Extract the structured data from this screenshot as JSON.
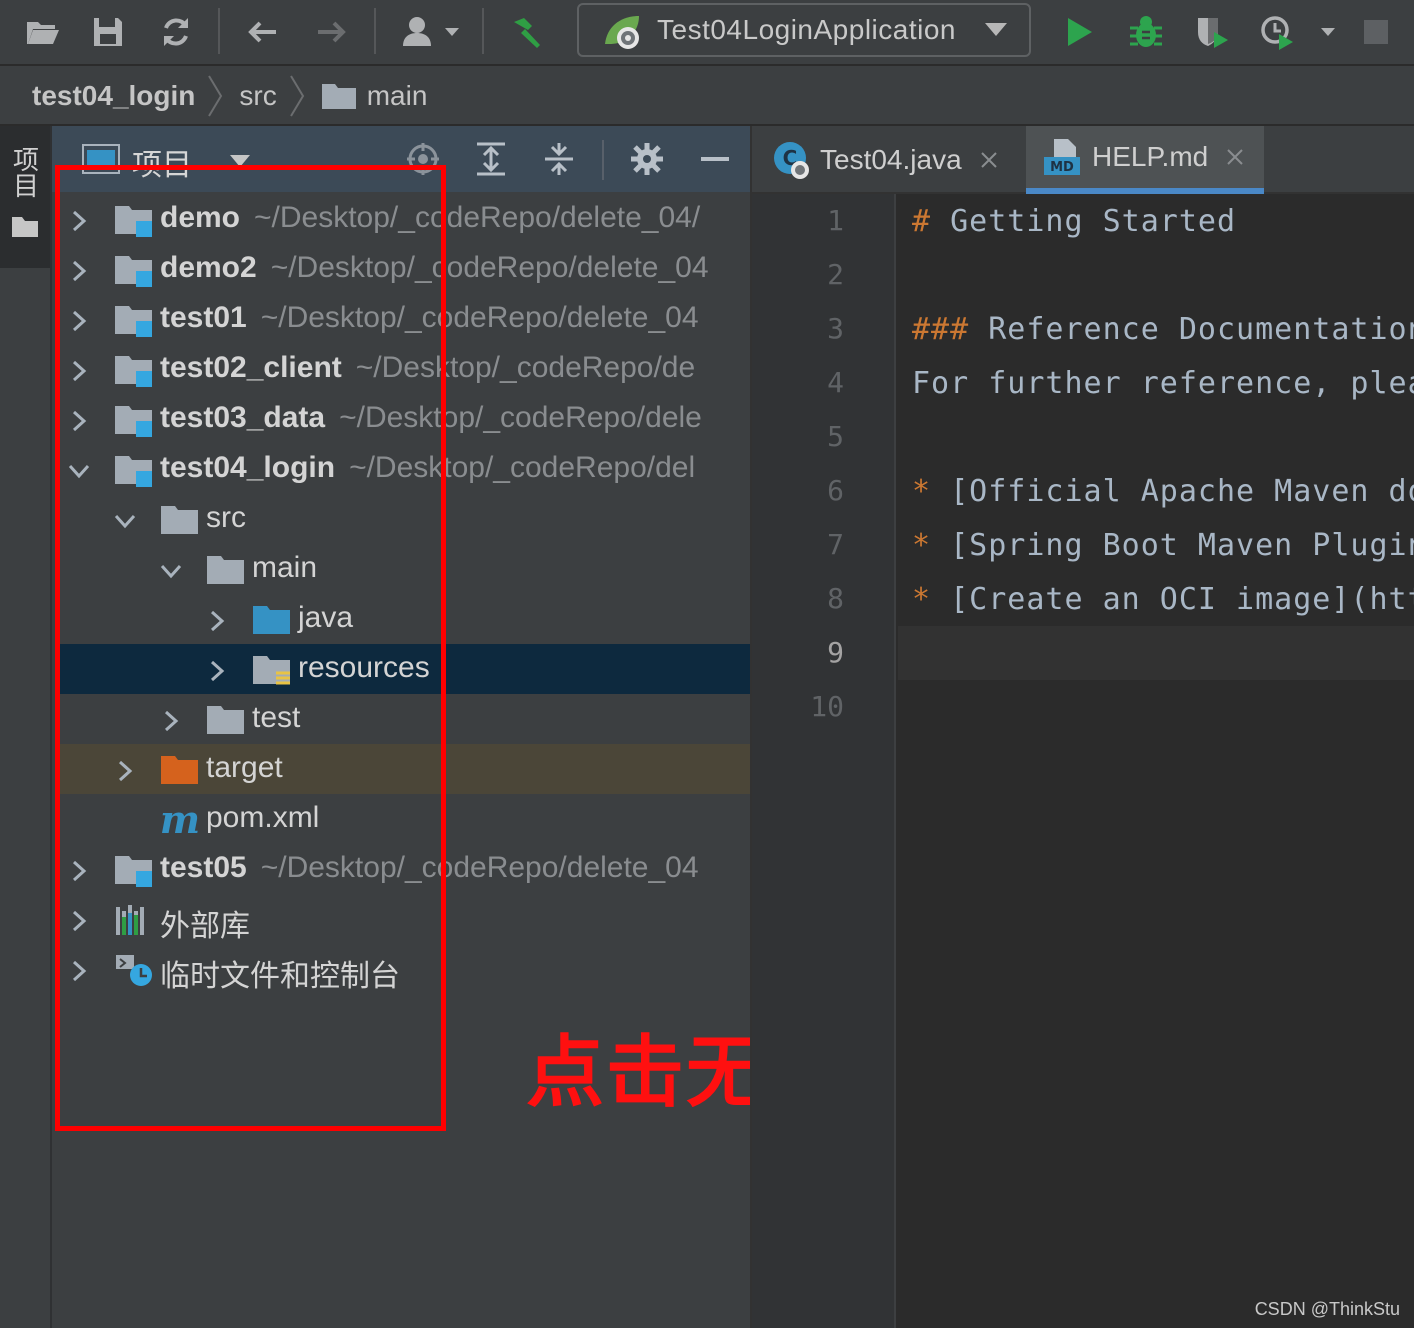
{
  "toolbar": {
    "run_config": "Test04LoginApplication"
  },
  "breadcrumb": [
    "test04_login",
    "src",
    "main"
  ],
  "left_strip": {
    "tab_label": "项目"
  },
  "project_panel": {
    "title": "项目",
    "tree": [
      {
        "name": "demo",
        "path": "~/Desktop/_codeRepo/delete_04/",
        "type": "module",
        "depth": 0,
        "expanded": false
      },
      {
        "name": "demo2",
        "path": "~/Desktop/_codeRepo/delete_04",
        "type": "module",
        "depth": 0,
        "expanded": false
      },
      {
        "name": "test01",
        "path": "~/Desktop/_codeRepo/delete_04",
        "type": "module",
        "depth": 0,
        "expanded": false
      },
      {
        "name": "test02_client",
        "path": "~/Desktop/_codeRepo/de",
        "type": "module",
        "depth": 0,
        "expanded": false
      },
      {
        "name": "test03_data",
        "path": "~/Desktop/_codeRepo/dele",
        "type": "module",
        "depth": 0,
        "expanded": false
      },
      {
        "name": "test04_login",
        "path": "~/Desktop/_codeRepo/del",
        "type": "module",
        "depth": 0,
        "expanded": true
      },
      {
        "name": "src",
        "path": "",
        "type": "folder",
        "depth": 1,
        "expanded": true
      },
      {
        "name": "main",
        "path": "",
        "type": "folder",
        "depth": 2,
        "expanded": true
      },
      {
        "name": "java",
        "path": "",
        "type": "source-folder",
        "depth": 3,
        "expanded": false
      },
      {
        "name": "resources",
        "path": "",
        "type": "resources-folder",
        "depth": 3,
        "expanded": false,
        "selected": true
      },
      {
        "name": "test",
        "path": "",
        "type": "folder",
        "depth": 2,
        "expanded": false
      },
      {
        "name": "target",
        "path": "",
        "type": "excluded-folder",
        "depth": 1,
        "expanded": false,
        "excluded": true
      },
      {
        "name": "pom.xml",
        "path": "",
        "type": "maven-file",
        "depth": 1,
        "leaf": true
      },
      {
        "name": "test05",
        "path": "~/Desktop/_codeRepo/delete_04",
        "type": "module",
        "depth": 0,
        "expanded": false
      },
      {
        "name": "外部库",
        "path": "",
        "type": "libraries",
        "depth": 0,
        "expanded": false
      },
      {
        "name": "临时文件和控制台",
        "path": "",
        "type": "scratches",
        "depth": 0,
        "expanded": false
      }
    ]
  },
  "annotation": {
    "text": "点击无反应"
  },
  "editor": {
    "tabs": [
      {
        "label": "Test04.java",
        "icon": "java-class-icon",
        "active": false
      },
      {
        "label": "HELP.md",
        "icon": "markdown-icon",
        "active": true
      }
    ],
    "current_line": 9,
    "lines": [
      {
        "n": "1",
        "mark": "#",
        "text": " Getting Started"
      },
      {
        "n": "2",
        "mark": "",
        "text": ""
      },
      {
        "n": "3",
        "mark": "###",
        "text": " Reference Documentation"
      },
      {
        "n": "4",
        "mark": "",
        "text": "For further reference, please"
      },
      {
        "n": "5",
        "mark": "",
        "text": ""
      },
      {
        "n": "6",
        "mark": "*",
        "text": " [Official Apache Maven docu"
      },
      {
        "n": "7",
        "mark": "*",
        "text": " [Spring Boot Maven Plugin R"
      },
      {
        "n": "8",
        "mark": "*",
        "text": " [Create an OCI image](https"
      },
      {
        "n": "9",
        "mark": "",
        "text": ""
      },
      {
        "n": "10",
        "mark": "",
        "text": ""
      }
    ]
  },
  "watermark": "CSDN @ThinkStu",
  "colors": {
    "accent": "#4a88c7",
    "selection": "#0d293e",
    "annotation": "#ff0000",
    "run": "#2da44e"
  }
}
